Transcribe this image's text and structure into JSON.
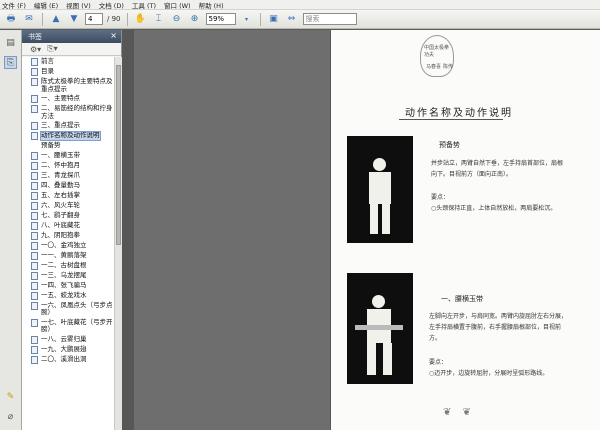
{
  "menu": [
    "文件 (F)",
    "编辑 (E)",
    "视图 (V)",
    "文档 (D)",
    "工具 (T)",
    "窗口 (W)",
    "帮助 (H)"
  ],
  "toolbar": {
    "page_current": "4",
    "page_total": "/ 90",
    "zoom": "59%",
    "search_placeholder": "搜索"
  },
  "panel": {
    "title": "书签",
    "close_glyph": "×"
  },
  "bookmarks": [
    {
      "label": "前言"
    },
    {
      "label": "目录"
    },
    {
      "label": "陈式太极拳的主要特点及重点提示"
    },
    {
      "label": "一、主要特点"
    },
    {
      "label": "二、易筋经的结构和拧身方法"
    },
    {
      "label": "三、重点提示"
    },
    {
      "label": "动作名称及动作说明",
      "selected": true
    },
    {
      "label": "预备势",
      "nodoc": true
    },
    {
      "label": "一、腰横玉带"
    },
    {
      "label": "二、怀中抱月"
    },
    {
      "label": "三、青龙探爪"
    },
    {
      "label": "四、叠量勤马"
    },
    {
      "label": "五、左右插掌"
    },
    {
      "label": "六、风火车轮"
    },
    {
      "label": "七、鹞子翻身"
    },
    {
      "label": "八、叶底藏花"
    },
    {
      "label": "九、阴阳抱拳"
    },
    {
      "label": "一〇、金鸡独立"
    },
    {
      "label": "一一、黄鹂落架"
    },
    {
      "label": "一二、古树盘根"
    },
    {
      "label": "一三、乌龙摆尾"
    },
    {
      "label": "一四、张飞骗马"
    },
    {
      "label": "一五、蛟龙戏水"
    },
    {
      "label": "一六、凤凰点头（弓步点腕）"
    },
    {
      "label": "一七、叶底藏花（弓步开膀）"
    },
    {
      "label": "一八、云雾归巢"
    },
    {
      "label": "一九、大鹏展翅"
    },
    {
      "label": "二〇、溪滑出洞"
    }
  ],
  "page": {
    "seal_top": "中国太极拳功夫",
    "seal_bottom": "陈传",
    "seal_left": "马春喜",
    "seal_right": "著",
    "heading": "动作名称及动作说明",
    "pose1_title": "预备势",
    "pose1_text": "并步站立，两臂自然下垂，左手持扇首部位，扇根向下。目视前方（面向正南）。",
    "pose1_points_title": "要点：",
    "pose1_points": "○头颈保持正直，上体自然放松，两肩要松沉。",
    "pose2_title": "一、腰横玉带",
    "pose2_text": "左脚向左开步，与肩同宽。两臂内旋屈肘左右分展，左手持扇横置于腹前，右手握腰扇根部位，目视前方。",
    "pose2_points_title": "要点：",
    "pose2_points": "○迈开步，边旋转屈肘，分展时呈弧形路线。",
    "footer": "❦ ❦"
  }
}
